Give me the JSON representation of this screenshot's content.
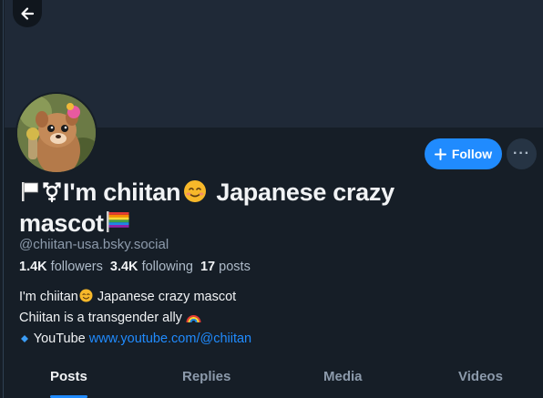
{
  "profile": {
    "name_part1": "I'm chiitan",
    "name_part2": " Japanese crazy",
    "name_part3": "mascot",
    "handle": "@chiitan-usa.bsky.social",
    "followers_count": "1.4K",
    "followers_label": "followers",
    "following_count": "3.4K",
    "following_label": "following",
    "posts_count": "17",
    "posts_label": "posts",
    "bio_line1": "I'm chiitan",
    "bio_line1b": " Japanese crazy mascot",
    "bio_line2": "Chiitan is a transgender ally",
    "bio_line3_label": " YouTube ",
    "bio_line3_link": "www.youtube.com/@chiitan"
  },
  "actions": {
    "follow_label": "Follow",
    "more_label": "···"
  },
  "tabs": [
    {
      "label": "Posts",
      "active": true
    },
    {
      "label": "Replies",
      "active": false
    },
    {
      "label": "Media",
      "active": false
    },
    {
      "label": "Videos",
      "active": false
    }
  ],
  "colors": {
    "background": "#161e27",
    "banner": "#1f2937",
    "accent": "#208bfe",
    "secondary_text": "#8c9aab"
  },
  "icons": {
    "back": "arrow-left-icon",
    "plus": "plus-icon",
    "more": "ellipsis-icon"
  }
}
